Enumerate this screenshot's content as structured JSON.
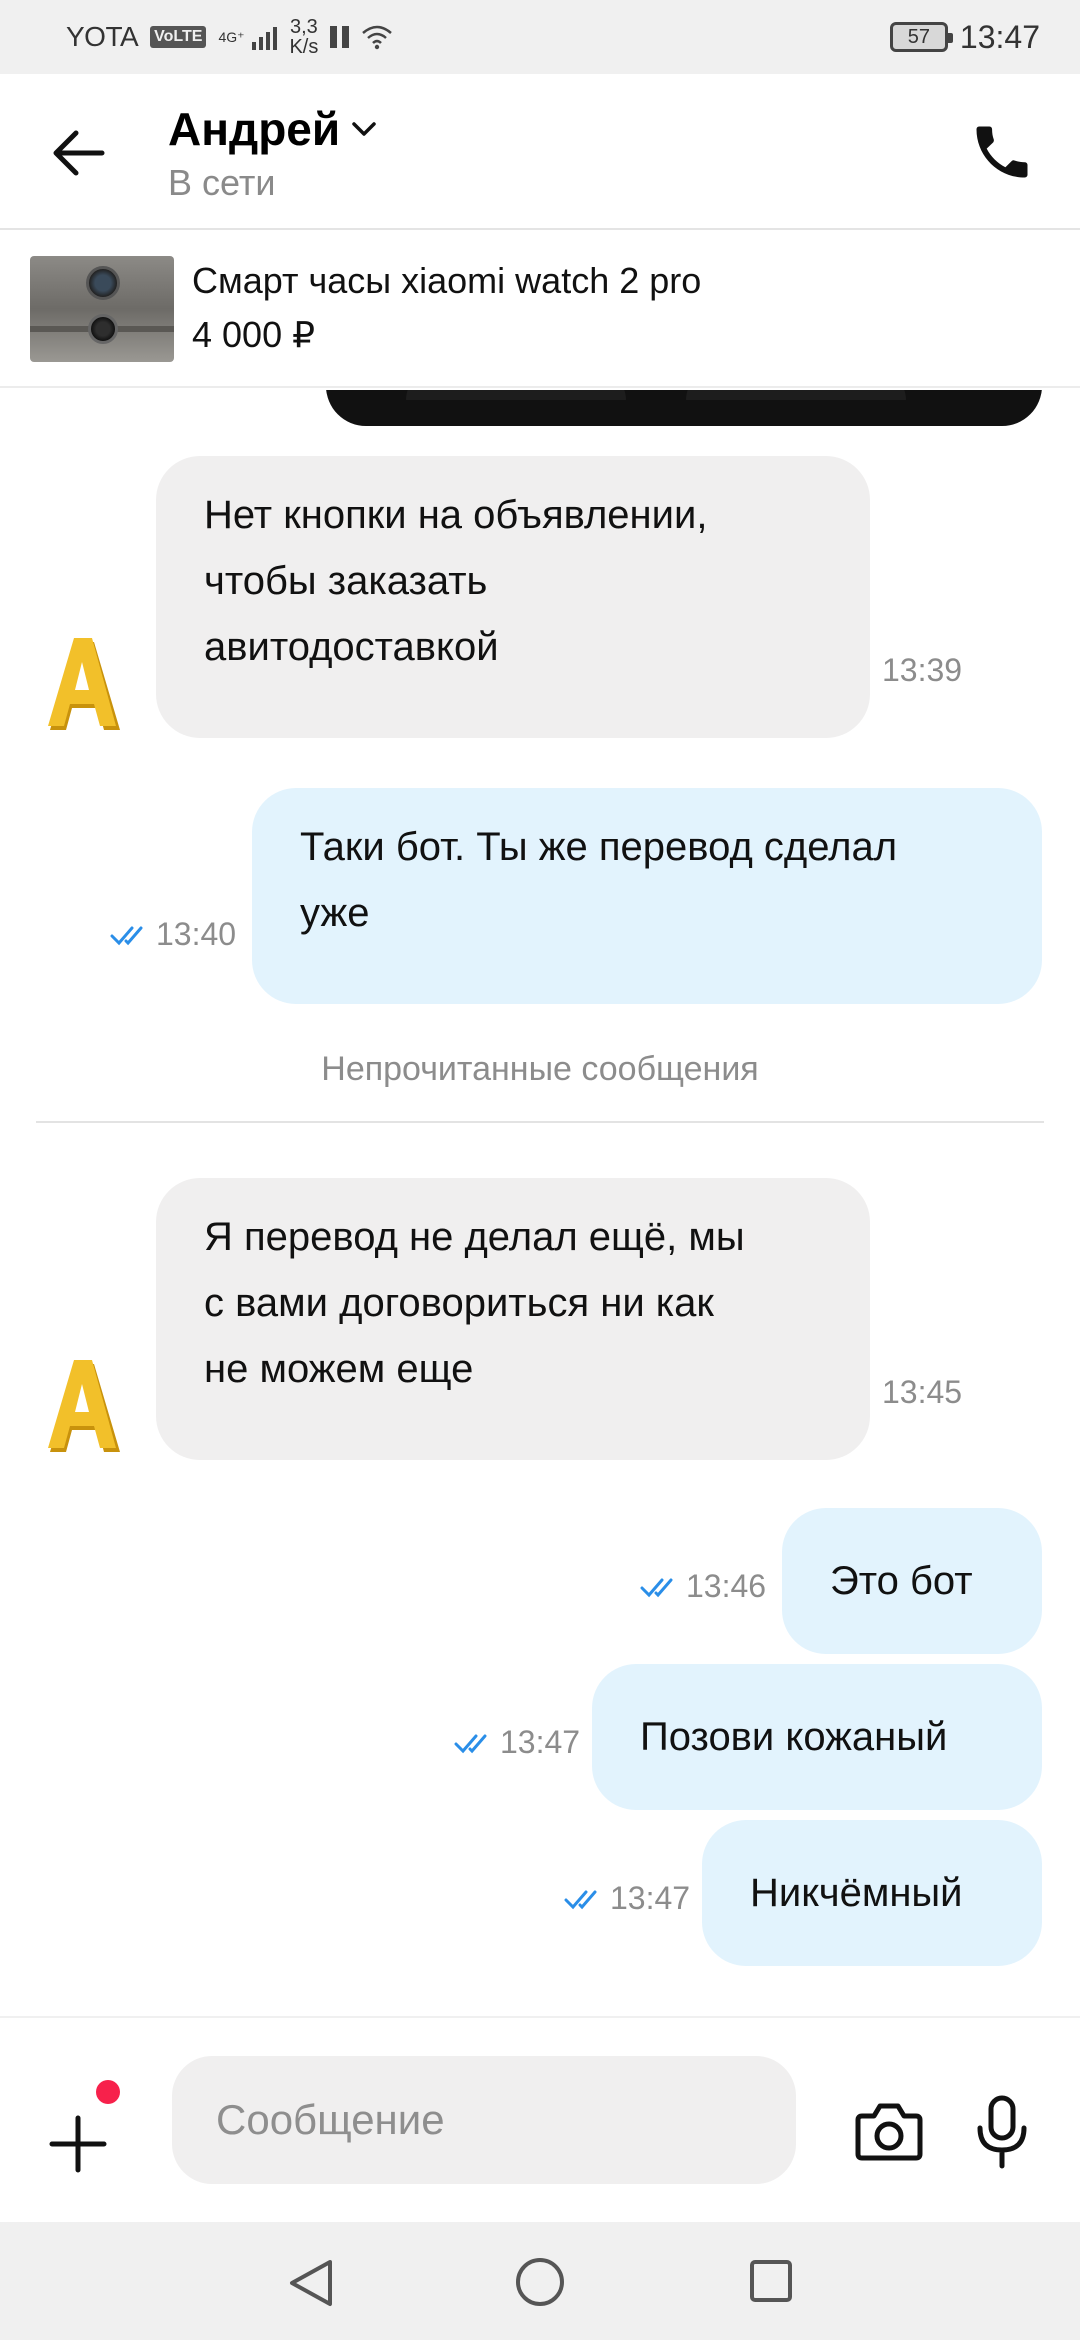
{
  "status_bar": {
    "carrier": "YOTA",
    "volte": "VoLTE",
    "network": "4G⁺",
    "speed_value": "3,3",
    "speed_unit": "K/s",
    "battery": "57",
    "time": "13:47"
  },
  "header": {
    "contact_name": "Андрей",
    "status": "В сети"
  },
  "ad": {
    "title": "Смарт часы xiaomi watch 2 pro",
    "price": "4 000 ₽"
  },
  "messages": [
    {
      "direction": "in",
      "lines": [
        "Нет кнопки на объявлении,",
        "чтобы заказать",
        "авитодоставкой"
      ],
      "time": "13:39"
    },
    {
      "direction": "out",
      "lines": [
        "Таки бот. Ты же перевод сделал",
        "уже"
      ],
      "time": "13:40",
      "read": true
    },
    {
      "direction": "in",
      "lines": [
        "Я перевод не делал ещё, мы",
        "с вами договориться ни как",
        "не можем еще"
      ],
      "time": "13:45"
    },
    {
      "direction": "out",
      "lines": [
        "Это бот"
      ],
      "time": "13:46",
      "read": true
    },
    {
      "direction": "out",
      "lines": [
        "Позови кожаный"
      ],
      "time": "13:47",
      "read": true
    },
    {
      "direction": "out",
      "lines": [
        "Никчёмный"
      ],
      "time": "13:47",
      "read": true
    }
  ],
  "unread_divider": "Непрочитанные сообщения",
  "composer": {
    "placeholder": "Сообщение"
  },
  "colors": {
    "incoming_bubble": "#f0efef",
    "outgoing_bubble": "#e2f3fd",
    "read_ticks": "#2a8ee8",
    "notification_dot": "#f7214b",
    "avatar_gold": "#e8b320"
  },
  "icons": [
    "back-arrow-icon",
    "chevron-down-icon",
    "phone-icon",
    "plus-icon",
    "camera-icon",
    "microphone-icon",
    "double-check-icon",
    "nav-back-icon",
    "nav-home-icon",
    "nav-recent-icon",
    "wifi-icon",
    "signal-icon"
  ]
}
